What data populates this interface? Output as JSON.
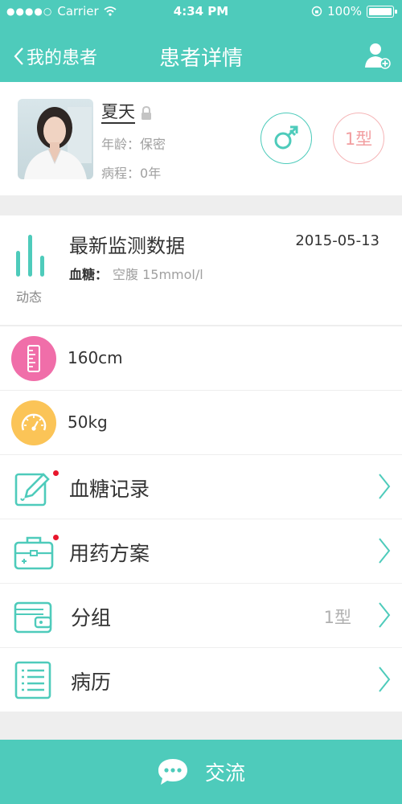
{
  "status_bar": {
    "carrier": "Carrier",
    "time": "4:34 PM",
    "battery": "100%"
  },
  "nav": {
    "back_label": "我的患者",
    "title": "患者详情"
  },
  "profile": {
    "name": "夏天",
    "age_label": "年龄：",
    "age_value": "保密",
    "course_label": "病程：",
    "course_value": "0年",
    "type_badge": "1型"
  },
  "monitor": {
    "icon_label": "动态",
    "title": "最新监测数据",
    "date": "2015-05-13",
    "metric_label": "血糖：",
    "metric_value": "空腹  15mmol/l"
  },
  "stats": {
    "height": "160cm",
    "weight": "50kg"
  },
  "menu": {
    "glucose": "血糖记录",
    "medication": "用药方案",
    "group": "分组",
    "group_value": "1型",
    "history": "病历"
  },
  "bottom": {
    "label": "交流"
  },
  "colors": {
    "primary": "#4ecbbb",
    "height_icon": "#f06ea9",
    "weight_icon": "#fbc457",
    "badge_pink": "#f29ea0",
    "dot_red": "#e8162c"
  }
}
